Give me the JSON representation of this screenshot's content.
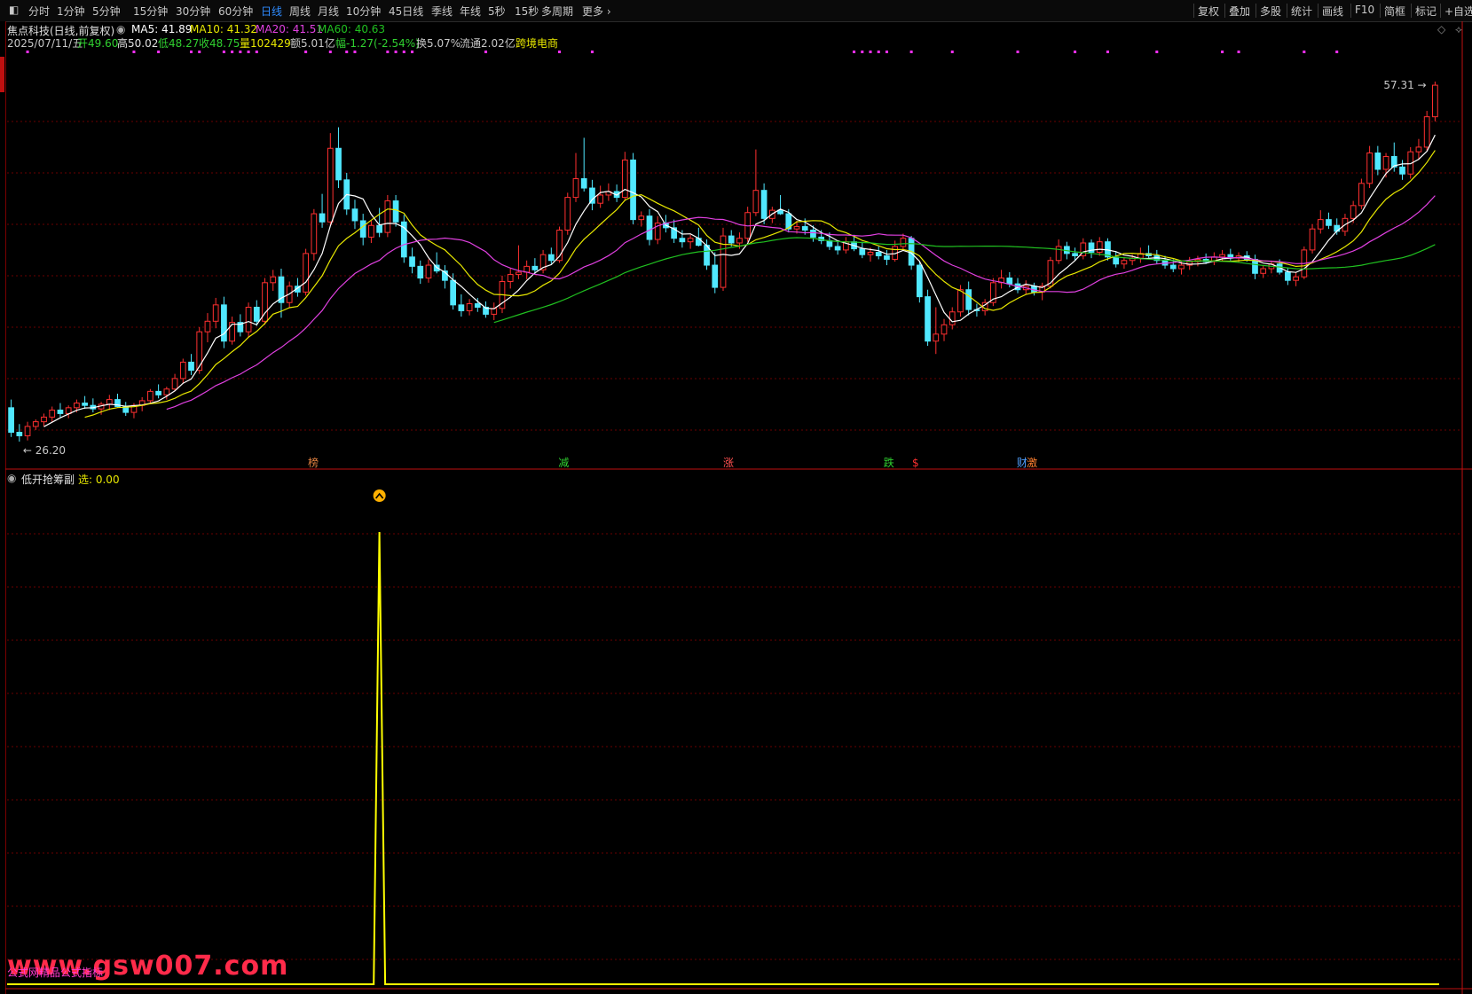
{
  "toolbar": {
    "periods": [
      "分时",
      "1分钟",
      "5分钟",
      "15分钟",
      "30分钟",
      "60分钟",
      "日线",
      "周线",
      "月线",
      "10分钟",
      "45日线",
      "季线",
      "年线",
      "5秒",
      "15秒",
      "多周期",
      "更多"
    ],
    "active_period": "日线",
    "tools": [
      "复权",
      "叠加",
      "多股",
      "统计",
      "画线",
      "F10",
      "简框",
      "标记",
      "+自选"
    ]
  },
  "stock": {
    "title": "焦点科技(日线,前复权)",
    "ma5": "MA5: 41.89",
    "ma10": "MA10: 41.32",
    "ma20": "MA20: 41.51",
    "ma60": "MA60: 40.63",
    "date": "2025/07/11/五",
    "open": "开49.60",
    "high": "高50.02",
    "low": "低48.27",
    "close": "收48.75",
    "volume": "量102429",
    "amount": "额5.01亿",
    "change": "幅-1.27(-2.54%)",
    "turnover": "换5.07%",
    "float_cap": "流通2.02亿",
    "concept": "跨境电商"
  },
  "colors": {
    "ma5": "#ffffff",
    "ma10": "#e8e800",
    "ma20": "#e040e0",
    "ma60": "#20c020",
    "up": "#ff3030",
    "down": "#50e8ff",
    "grid": "#6a0000",
    "signal": "#ffff00",
    "accent_active": "#2e8bff"
  },
  "chart_data": [
    {
      "type": "candlestick",
      "title": "焦点科技(日线,前复权)",
      "price_high_label": "57.31",
      "price_low_label": "26.20",
      "ylim": [
        26.2,
        57.31
      ],
      "event_labels": [
        "榜",
        "减",
        "涨",
        "跌",
        "$",
        "财",
        "激"
      ],
      "candles": [
        [
          29.4,
          30.1,
          26.9,
          27.3
        ],
        [
          27.3,
          28.0,
          26.5,
          27.0
        ],
        [
          27.0,
          28.2,
          26.6,
          27.8
        ],
        [
          27.8,
          28.4,
          27.5,
          28.2
        ],
        [
          28.2,
          28.9,
          27.8,
          28.6
        ],
        [
          28.6,
          29.5,
          28.2,
          29.2
        ],
        [
          29.2,
          29.8,
          28.6,
          28.9
        ],
        [
          28.9,
          29.6,
          28.5,
          29.4
        ],
        [
          29.4,
          30.1,
          29.0,
          29.8
        ],
        [
          29.8,
          30.4,
          29.3,
          29.6
        ],
        [
          29.6,
          30.2,
          29.0,
          29.3
        ],
        [
          29.3,
          29.9,
          28.8,
          29.7
        ],
        [
          29.7,
          30.5,
          29.2,
          30.1
        ],
        [
          30.1,
          30.6,
          29.4,
          29.5
        ],
        [
          29.5,
          29.9,
          28.7,
          29.0
        ],
        [
          29.0,
          29.8,
          28.5,
          29.6
        ],
        [
          29.6,
          30.3,
          29.1,
          30.0
        ],
        [
          30.0,
          31.0,
          29.7,
          30.8
        ],
        [
          30.8,
          31.4,
          30.2,
          30.5
        ],
        [
          30.5,
          31.2,
          30.1,
          31.0
        ],
        [
          31.0,
          32.3,
          30.8,
          31.9
        ],
        [
          31.9,
          33.6,
          31.5,
          33.3
        ],
        [
          33.3,
          34.0,
          32.2,
          32.6
        ],
        [
          32.6,
          36.3,
          32.3,
          35.9
        ],
        [
          35.9,
          37.5,
          35.0,
          36.8
        ],
        [
          36.8,
          38.8,
          36.2,
          38.2
        ],
        [
          38.2,
          38.9,
          34.5,
          35.1
        ],
        [
          35.1,
          37.2,
          34.8,
          36.7
        ],
        [
          36.7,
          37.4,
          35.5,
          35.9
        ],
        [
          35.9,
          38.4,
          35.4,
          38.0
        ],
        [
          38.0,
          38.6,
          36.4,
          36.8
        ],
        [
          36.8,
          40.5,
          36.5,
          40.1
        ],
        [
          40.1,
          41.2,
          39.4,
          40.6
        ],
        [
          40.6,
          41.3,
          37.1,
          38.4
        ],
        [
          38.4,
          40.2,
          38.0,
          39.8
        ],
        [
          39.8,
          40.5,
          38.9,
          39.3
        ],
        [
          39.3,
          43.0,
          39.0,
          42.6
        ],
        [
          42.6,
          46.4,
          42.0,
          46.0
        ],
        [
          46.0,
          47.7,
          44.8,
          45.3
        ],
        [
          45.3,
          52.9,
          45.0,
          51.6
        ],
        [
          51.6,
          53.4,
          48.2,
          48.9
        ],
        [
          48.9,
          49.5,
          45.9,
          46.4
        ],
        [
          46.4,
          47.2,
          44.7,
          45.4
        ],
        [
          45.4,
          46.0,
          43.3,
          44.0
        ],
        [
          44.0,
          45.4,
          43.5,
          45.0
        ],
        [
          45.0,
          46.5,
          44.0,
          44.4
        ],
        [
          44.4,
          47.6,
          44.0,
          47.1
        ],
        [
          47.1,
          47.6,
          44.9,
          45.3
        ],
        [
          45.3,
          45.9,
          41.8,
          42.3
        ],
        [
          42.3,
          43.1,
          40.9,
          41.5
        ],
        [
          41.5,
          42.0,
          40.0,
          40.5
        ],
        [
          40.5,
          42.1,
          40.1,
          41.6
        ],
        [
          41.6,
          42.7,
          40.9,
          41.1
        ],
        [
          41.1,
          41.6,
          39.6,
          40.3
        ],
        [
          40.3,
          40.9,
          37.8,
          38.2
        ],
        [
          38.2,
          39.1,
          37.2,
          37.7
        ],
        [
          37.7,
          38.7,
          37.3,
          38.3
        ],
        [
          38.3,
          38.8,
          37.6,
          38.0
        ],
        [
          38.0,
          38.5,
          37.1,
          37.4
        ],
        [
          37.4,
          38.4,
          36.9,
          37.9
        ],
        [
          37.9,
          40.7,
          37.5,
          40.2
        ],
        [
          40.2,
          41.3,
          39.6,
          40.8
        ],
        [
          40.8,
          43.3,
          40.4,
          41.0
        ],
        [
          41.0,
          42.0,
          40.4,
          41.5
        ],
        [
          41.5,
          42.2,
          40.8,
          41.2
        ],
        [
          41.2,
          42.9,
          40.9,
          42.5
        ],
        [
          42.5,
          43.1,
          41.7,
          42.0
        ],
        [
          42.0,
          44.9,
          41.8,
          44.6
        ],
        [
          44.6,
          47.8,
          44.2,
          47.4
        ],
        [
          47.4,
          51.2,
          47.0,
          49.0
        ],
        [
          49.0,
          52.5,
          47.9,
          48.2
        ],
        [
          48.2,
          48.9,
          46.3,
          46.9
        ],
        [
          46.9,
          48.4,
          46.5,
          47.6
        ],
        [
          47.6,
          48.6,
          47.1,
          47.9
        ],
        [
          47.9,
          48.5,
          47.0,
          47.4
        ],
        [
          47.4,
          51.3,
          47.1,
          50.6
        ],
        [
          50.6,
          51.2,
          45.1,
          45.5
        ],
        [
          45.5,
          46.2,
          44.9,
          45.8
        ],
        [
          45.8,
          46.4,
          43.3,
          43.8
        ],
        [
          43.8,
          45.8,
          43.4,
          45.2
        ],
        [
          45.2,
          45.9,
          44.4,
          44.8
        ],
        [
          44.8,
          45.5,
          43.5,
          43.9
        ],
        [
          43.9,
          44.6,
          43.1,
          43.6
        ],
        [
          43.6,
          44.2,
          43.0,
          43.9
        ],
        [
          43.9,
          44.8,
          43.2,
          43.3
        ],
        [
          43.3,
          43.8,
          41.2,
          41.6
        ],
        [
          41.6,
          42.7,
          39.2,
          39.7
        ],
        [
          39.7,
          44.8,
          39.4,
          44.1
        ],
        [
          44.1,
          44.6,
          43.2,
          43.5
        ],
        [
          43.5,
          44.4,
          43.0,
          43.9
        ],
        [
          43.9,
          46.6,
          43.6,
          46.1
        ],
        [
          46.1,
          51.5,
          45.8,
          48.0
        ],
        [
          48.0,
          48.6,
          45.1,
          45.6
        ],
        [
          45.6,
          46.6,
          45.2,
          46.3
        ],
        [
          46.3,
          47.6,
          45.9,
          46.0
        ],
        [
          46.0,
          46.4,
          44.4,
          44.7
        ],
        [
          44.7,
          45.4,
          44.3,
          44.9
        ],
        [
          44.9,
          45.6,
          44.2,
          44.6
        ],
        [
          44.6,
          45.0,
          43.6,
          44.0
        ],
        [
          44.0,
          44.6,
          43.4,
          43.7
        ],
        [
          43.7,
          44.4,
          42.9,
          43.2
        ],
        [
          43.2,
          43.7,
          42.5,
          42.9
        ],
        [
          42.9,
          44.0,
          42.6,
          43.6
        ],
        [
          43.6,
          44.2,
          42.8,
          43.0
        ],
        [
          43.0,
          43.6,
          42.2,
          42.5
        ],
        [
          42.5,
          43.1,
          41.9,
          42.7
        ],
        [
          42.7,
          43.2,
          42.1,
          42.4
        ],
        [
          42.4,
          42.9,
          41.6,
          42.1
        ],
        [
          42.1,
          43.7,
          41.9,
          43.2
        ],
        [
          43.2,
          44.3,
          42.9,
          43.9
        ],
        [
          43.9,
          44.1,
          41.2,
          41.6
        ],
        [
          41.6,
          41.9,
          38.4,
          38.9
        ],
        [
          38.9,
          39.5,
          34.7,
          35.1
        ],
        [
          35.1,
          38.0,
          34.0,
          35.7
        ],
        [
          35.7,
          37.0,
          35.1,
          36.5
        ],
        [
          36.5,
          38.0,
          36.1,
          37.6
        ],
        [
          37.6,
          39.9,
          37.2,
          39.5
        ],
        [
          39.5,
          40.2,
          37.3,
          37.8
        ],
        [
          37.8,
          38.3,
          37.2,
          37.7
        ],
        [
          37.7,
          38.7,
          37.3,
          38.4
        ],
        [
          38.4,
          40.5,
          38.1,
          40.1
        ],
        [
          40.1,
          41.2,
          39.6,
          40.5
        ],
        [
          40.5,
          41.0,
          39.7,
          40.0
        ],
        [
          40.0,
          40.5,
          39.2,
          39.5
        ],
        [
          39.5,
          40.3,
          39.1,
          39.8
        ],
        [
          39.8,
          40.1,
          39.0,
          39.3
        ],
        [
          39.3,
          40.1,
          38.6,
          39.8
        ],
        [
          39.8,
          42.3,
          39.6,
          42.0
        ],
        [
          42.0,
          43.8,
          41.7,
          43.2
        ],
        [
          43.2,
          43.6,
          42.1,
          42.6
        ],
        [
          42.6,
          43.1,
          42.0,
          42.4
        ],
        [
          42.4,
          43.9,
          42.1,
          43.5
        ],
        [
          43.5,
          43.8,
          42.2,
          42.7
        ],
        [
          42.7,
          44.0,
          42.4,
          43.6
        ],
        [
          43.6,
          43.9,
          42.0,
          42.3
        ],
        [
          42.3,
          42.8,
          41.4,
          41.7
        ],
        [
          41.7,
          42.3,
          41.3,
          42.0
        ],
        [
          42.0,
          42.5,
          41.6,
          42.2
        ],
        [
          42.2,
          43.1,
          41.8,
          42.6
        ],
        [
          42.6,
          43.3,
          42.2,
          42.4
        ],
        [
          42.4,
          42.9,
          41.7,
          42.0
        ],
        [
          42.0,
          42.4,
          41.3,
          41.6
        ],
        [
          41.6,
          42.1,
          41.0,
          41.3
        ],
        [
          41.3,
          41.9,
          40.8,
          41.6
        ],
        [
          41.6,
          42.3,
          41.2,
          41.9
        ],
        [
          41.9,
          42.4,
          41.5,
          42.1
        ],
        [
          42.1,
          42.6,
          41.7,
          41.9
        ],
        [
          41.9,
          42.7,
          41.6,
          42.3
        ],
        [
          42.3,
          42.9,
          41.9,
          42.5
        ],
        [
          42.5,
          43.0,
          42.0,
          42.2
        ],
        [
          42.2,
          42.7,
          41.8,
          42.4
        ],
        [
          42.4,
          42.8,
          41.9,
          42.1
        ],
        [
          42.1,
          42.5,
          40.4,
          40.9
        ],
        [
          40.9,
          41.6,
          40.5,
          41.3
        ],
        [
          41.3,
          42.0,
          40.9,
          41.7
        ],
        [
          41.7,
          42.1,
          40.8,
          41.0
        ],
        [
          41.0,
          41.4,
          39.9,
          40.3
        ],
        [
          40.3,
          41.0,
          39.8,
          40.6
        ],
        [
          40.6,
          43.2,
          40.4,
          42.9
        ],
        [
          42.9,
          45.1,
          42.6,
          44.7
        ],
        [
          44.7,
          46.3,
          44.3,
          45.5
        ],
        [
          45.5,
          46.1,
          44.7,
          45.0
        ],
        [
          45.0,
          45.6,
          44.2,
          44.5
        ],
        [
          44.5,
          46.0,
          44.1,
          45.6
        ],
        [
          45.6,
          47.1,
          45.2,
          46.7
        ],
        [
          46.7,
          49.0,
          46.4,
          48.6
        ],
        [
          48.6,
          51.8,
          48.2,
          51.2
        ],
        [
          51.2,
          51.8,
          49.3,
          49.8
        ],
        [
          49.8,
          51.2,
          49.1,
          50.9
        ],
        [
          50.9,
          52.1,
          49.6,
          50.0
        ],
        [
          50.0,
          50.6,
          48.9,
          49.4
        ],
        [
          49.4,
          51.7,
          49.0,
          51.3
        ],
        [
          51.3,
          52.4,
          50.6,
          51.7
        ],
        [
          51.7,
          54.8,
          51.4,
          54.3
        ],
        [
          54.3,
          57.31,
          53.9,
          57.0
        ]
      ]
    },
    {
      "type": "line",
      "title": "低开抢筹副",
      "series": [
        {
          "name": "选",
          "value_label": "选: 0.00"
        }
      ],
      "spike_index": 45,
      "spike_value": 1.0,
      "baseline_value": 0.0
    }
  ],
  "watermark": {
    "text": "www.gsw007.com",
    "sub": "公式网精品公式指标"
  }
}
